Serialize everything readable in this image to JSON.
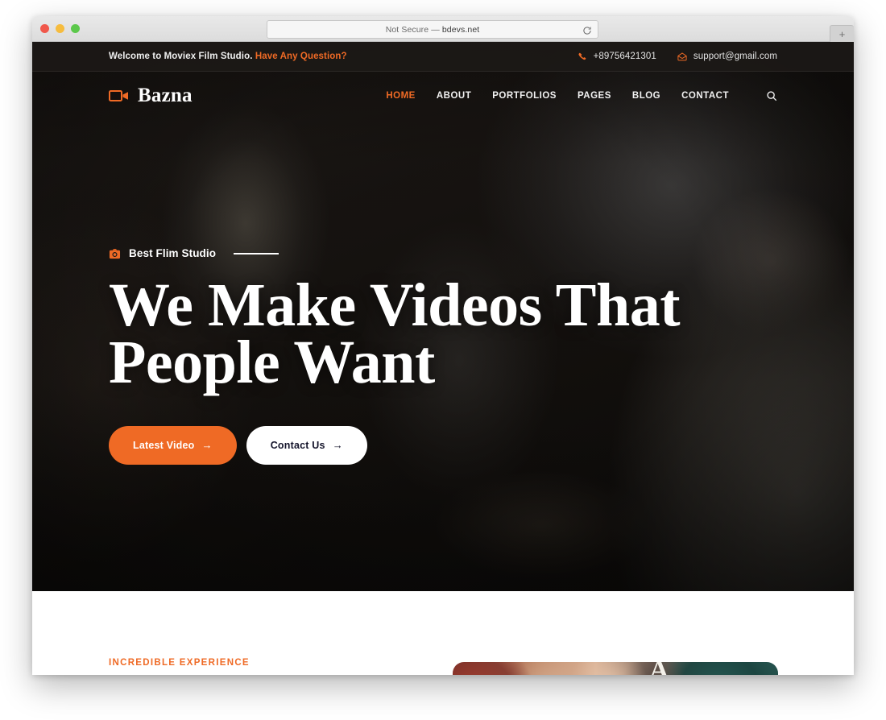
{
  "browser": {
    "url_prefix": "Not Secure — ",
    "url": "bdevs.net",
    "reload_icon": "reload-icon",
    "newtab_label": "+",
    "traffic_lights": [
      "close",
      "minimize",
      "maximize"
    ]
  },
  "topbar": {
    "welcome_text": "Welcome to Moviex Film Studio.",
    "question_link": "Have Any Question?",
    "phone": "+89756421301",
    "email": "support@gmail.com",
    "phone_icon": "phone-icon",
    "email_icon": "envelope-icon"
  },
  "nav": {
    "brand": "Bazna",
    "brand_icon": "video-camera-icon",
    "search_icon": "search-icon",
    "links": [
      {
        "label": "HOME",
        "active": true
      },
      {
        "label": "ABOUT",
        "active": false
      },
      {
        "label": "PORTFOLIOS",
        "active": false
      },
      {
        "label": "PAGES",
        "active": false
      },
      {
        "label": "BLOG",
        "active": false
      },
      {
        "label": "CONTACT",
        "active": false
      }
    ]
  },
  "hero": {
    "eyebrow": "Best Flim Studio",
    "eyebrow_icon": "photo-camera-icon",
    "title_line1": "We Make Videos That",
    "title_line2": "People Want",
    "primary_button": "Latest Video",
    "secondary_button": "Contact Us",
    "button_arrow": "→"
  },
  "next_section": {
    "label": "INCREDIBLE EXPERIENCE",
    "image_letter": "A"
  },
  "colors": {
    "accent": "#ef6a25",
    "topbar_bg": "#1c1917",
    "hero_bg": "#14110f",
    "text_light": "#ffffff",
    "button_secondary_text": "#14142b"
  }
}
